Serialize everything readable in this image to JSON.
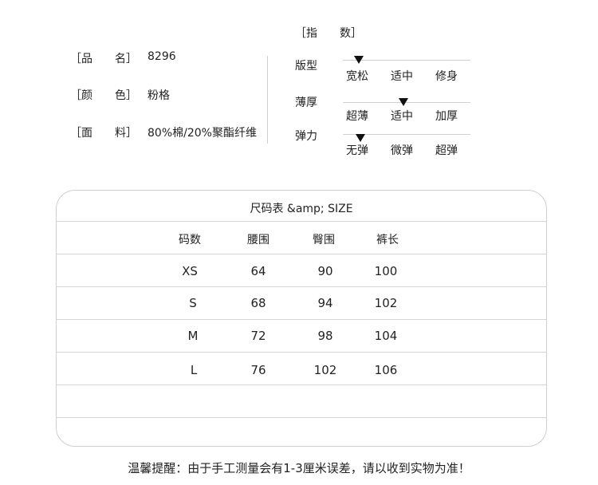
{
  "info": {
    "name_label": "［品　　名］",
    "name_value": "8296",
    "color_label": "［颜　　色］",
    "color_value": "粉格",
    "fabric_label": "［面　　料］",
    "fabric_value": "80%棉/20%聚酯纤维"
  },
  "index": {
    "title": "［指　　数］",
    "rows": [
      {
        "label": "版型",
        "options": [
          "宽松",
          "适中",
          "修身"
        ],
        "selected_index": 0
      },
      {
        "label": "薄厚",
        "options": [
          "超薄",
          "适中",
          "加厚"
        ],
        "selected_index": 1
      },
      {
        "label": "弹力",
        "options": [
          "无弹",
          "微弹",
          "超弹"
        ],
        "selected_index": 0
      }
    ]
  },
  "size_table": {
    "title": "尺码表 &amp; SIZE",
    "headers": [
      "码数",
      "腰围",
      "臀围",
      "裤长"
    ],
    "rows": [
      [
        "XS",
        "64",
        "90",
        "100"
      ],
      [
        "S",
        "68",
        "94",
        "102"
      ],
      [
        "M",
        "72",
        "98",
        "104"
      ],
      [
        "L",
        "76",
        "102",
        "106"
      ]
    ]
  },
  "note": "温馨提醒：由于手工测量会有1-3厘米误差，请以收到实物为准！"
}
